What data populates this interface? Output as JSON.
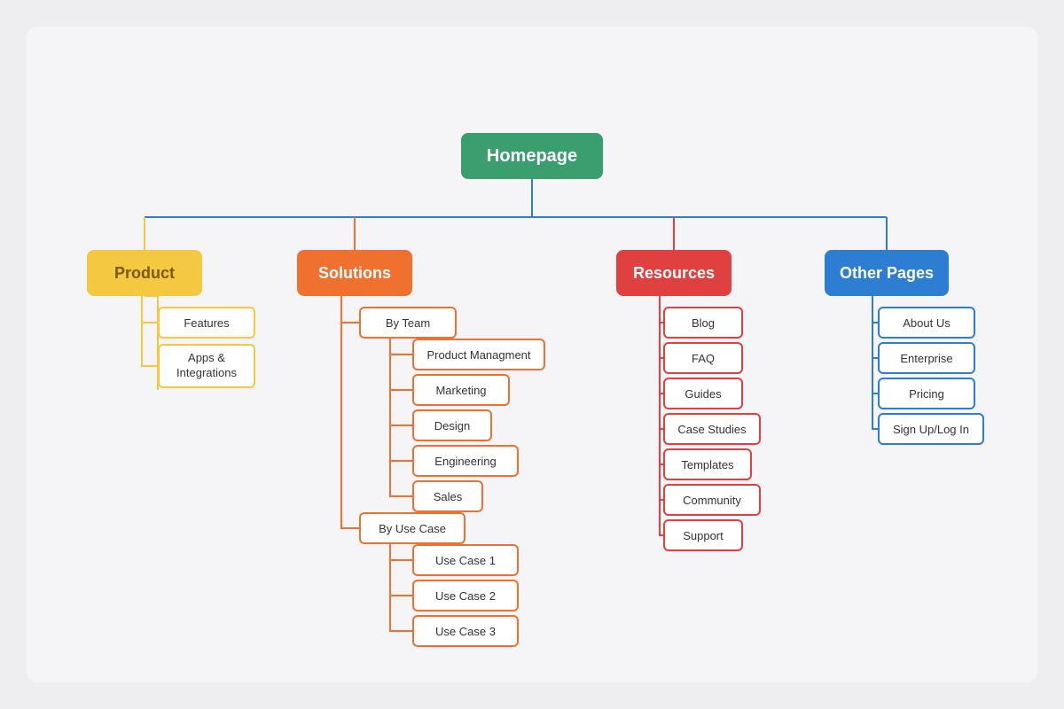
{
  "nodes": {
    "homepage": "Homepage",
    "product": "Product",
    "solutions": "Solutions",
    "resources": "Resources",
    "otherpages": "Other Pages",
    "features": "Features",
    "apps": "Apps & Integrations",
    "byteam": "By Team",
    "pm": "Product Managment",
    "marketing": "Marketing",
    "design": "Design",
    "engineering": "Engineering",
    "sales": "Sales",
    "byusecase": "By Use Case",
    "uc1": "Use Case 1",
    "uc2": "Use Case 2",
    "uc3": "Use Case 3",
    "blog": "Blog",
    "faq": "FAQ",
    "guides": "Guides",
    "casestudies": "Case Studies",
    "templates": "Templates",
    "community": "Community",
    "support": "Support",
    "aboutus": "About Us",
    "enterprise": "Enterprise",
    "pricing": "Pricing",
    "signup": "Sign Up/Log In"
  },
  "colors": {
    "homepage": "#3a9e6e",
    "yellow": "#f5c842",
    "orange": "#f07030",
    "red": "#e04040",
    "blue": "#2d7dd2"
  }
}
